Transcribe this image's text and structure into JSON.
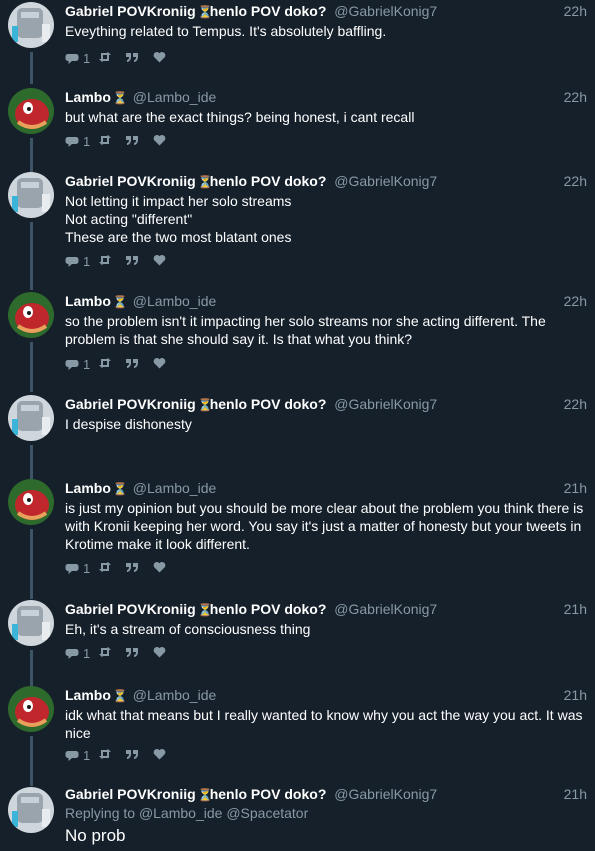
{
  "users": {
    "gabriel": {
      "name": "Gabriel POVKroniig",
      "name_suffix": "henlo POV doko?",
      "handle": "@GabrielKonig7"
    },
    "lambo": {
      "name": "Lambo",
      "handle": "@Lambo_ide"
    }
  },
  "tweets": [
    {
      "author": "gabriel",
      "time": "22h",
      "lines": [
        "Eveything related to Tempus. It's absolutely baffling."
      ],
      "reply_count": "1"
    },
    {
      "author": "lambo",
      "time": "22h",
      "lines": [
        "but what are the exact things? being honest, i cant recall"
      ],
      "reply_count": "1"
    },
    {
      "author": "gabriel",
      "time": "22h",
      "lines": [
        "Not letting it impact her solo streams",
        "Not acting \"different\"",
        "These are the two most blatant ones"
      ],
      "reply_count": "1"
    },
    {
      "author": "lambo",
      "time": "22h",
      "lines": [
        "so the problem isn't it impacting her solo streams nor she acting different. The",
        "problem is that she should say it. Is that what you think?"
      ],
      "reply_count": "1"
    },
    {
      "author": "gabriel",
      "time": "22h",
      "lines": [
        "I despise dishonesty"
      ],
      "reply_count": ""
    },
    {
      "author": "lambo",
      "time": "21h",
      "lines": [
        "is just my opinion but you should be more clear about the problem you think there is",
        "with Kronii keeping her word. You say it's just a matter of honesty but your tweets in",
        "Krotime make it look different."
      ],
      "reply_count": "1"
    },
    {
      "author": "gabriel",
      "time": "21h",
      "lines": [
        "Eh, it's a stream of consciousness thing"
      ],
      "reply_count": "1"
    },
    {
      "author": "lambo",
      "time": "21h",
      "lines": [
        "idk what that means but I really wanted to know why you act the way you act. It was",
        "nice"
      ],
      "reply_count": "1"
    },
    {
      "author": "gabriel",
      "time": "21h",
      "replying_to_label": "Replying to",
      "replying_to": [
        "@Lambo_ide",
        "@Spacetator"
      ],
      "lines": [
        "No prob"
      ]
    }
  ],
  "icons": {
    "reply": "reply-icon",
    "retweet": "retweet-icon",
    "quote": "quote-icon",
    "like": "like-icon",
    "hourglass": "hourglass-icon"
  },
  "colors": {
    "background": "#15202b",
    "secondary_text": "#8899a6",
    "thread_line": "#3d5466"
  }
}
